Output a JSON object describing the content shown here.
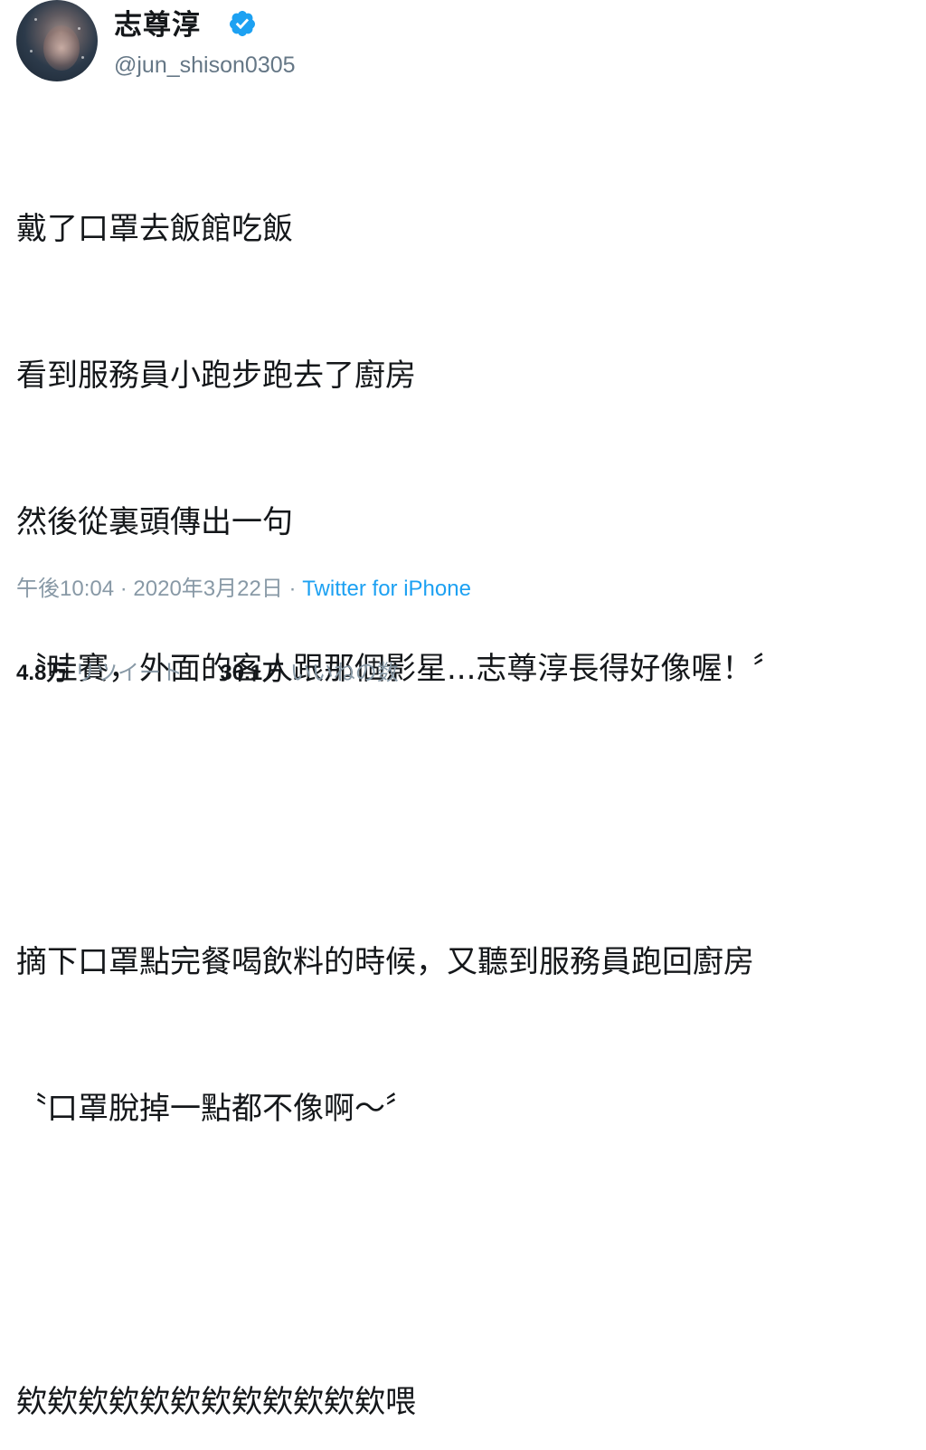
{
  "user": {
    "name": "志尊淳",
    "handle": "@jun_shison0305",
    "verified": true
  },
  "tweet": {
    "lines": [
      "戴了口罩去飯館吃飯",
      "看到服務員小跑步跑去了廚房",
      "然後從裏頭傳出一句",
      "〝哇賽，外面的客人跟那個影星...志尊淳長得好像喔！〞",
      "",
      "摘下口罩點完餐喝飲料的時候，又聽到服務員跑回廚房",
      "〝口罩脫掉一點都不像啊～〞",
      "",
      "欸欸欸欸欸欸欸欸欸欸欸欸喂"
    ]
  },
  "meta": {
    "time": "午後10:04",
    "date": "2020年3月22日",
    "separator": "·",
    "source": "Twitter for iPhone"
  },
  "stats": {
    "retweets_count": "4.8万",
    "retweets_label": "リツイート",
    "likes_count": "30.1万",
    "likes_label": "いいねの数"
  },
  "colors": {
    "verified": "#1da1f2",
    "secondary": "#8899a6",
    "link": "#1da1f2"
  }
}
